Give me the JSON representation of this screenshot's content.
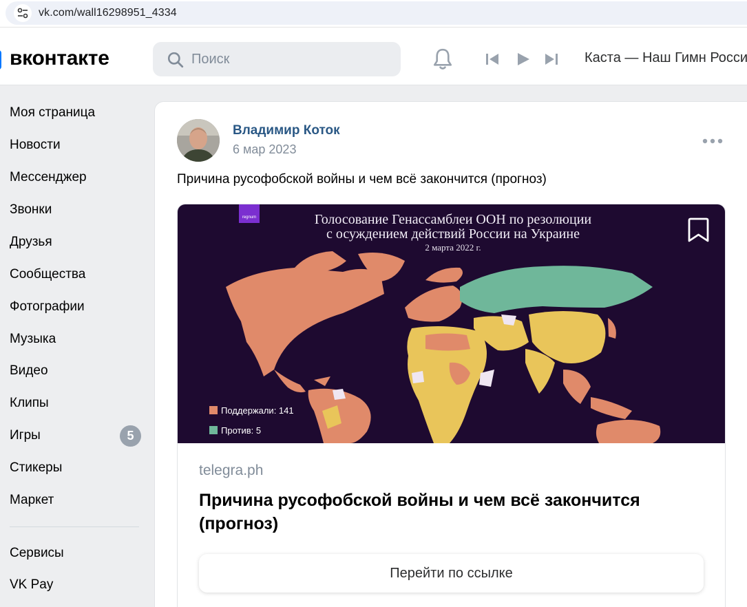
{
  "browser": {
    "url": "vk.com/wall16298951_4334"
  },
  "header": {
    "logo": "вконтакте",
    "search_placeholder": "Поиск",
    "now_playing": "Каста — Наш Гимн Россия"
  },
  "sidebar": {
    "items": [
      {
        "label": "Моя страница"
      },
      {
        "label": "Новости"
      },
      {
        "label": "Мессенджер"
      },
      {
        "label": "Звонки"
      },
      {
        "label": "Друзья"
      },
      {
        "label": "Сообщества"
      },
      {
        "label": "Фотографии"
      },
      {
        "label": "Музыка"
      },
      {
        "label": "Видео"
      },
      {
        "label": "Клипы"
      },
      {
        "label": "Игры",
        "badge": "5"
      },
      {
        "label": "Стикеры"
      },
      {
        "label": "Маркет"
      }
    ],
    "extra_items": [
      {
        "label": "Сервисы"
      },
      {
        "label": "VK Pay"
      }
    ]
  },
  "post": {
    "author": "Владимир Коток",
    "date": "6 мар 2023",
    "text": "Причина русофобской войны и чем всё закончится (прогноз)",
    "attachment": {
      "image": {
        "logo": "regnum",
        "title_line1": "Голосование Генассамблеи ООН по резолюции",
        "title_line2": "с осуждением действий России на Украине",
        "subtitle": "2 марта 2022 г.",
        "legend": [
          {
            "label": "Поддержали: 141",
            "color": "#e08a6a"
          },
          {
            "label": "Против: 5",
            "color": "#6fb79a"
          }
        ],
        "colors": {
          "background": "#1e0a30",
          "abstained": "#e9c55a",
          "absent": "#efe6f2"
        }
      },
      "domain": "telegra.ph",
      "title": "Причина русофобской войны и чем всё закончится (прогноз)",
      "button": "Перейти по ссылке"
    }
  },
  "colors": {
    "accent": "#0077ff",
    "link": "#2a5885",
    "page_bg": "#edeef0"
  }
}
